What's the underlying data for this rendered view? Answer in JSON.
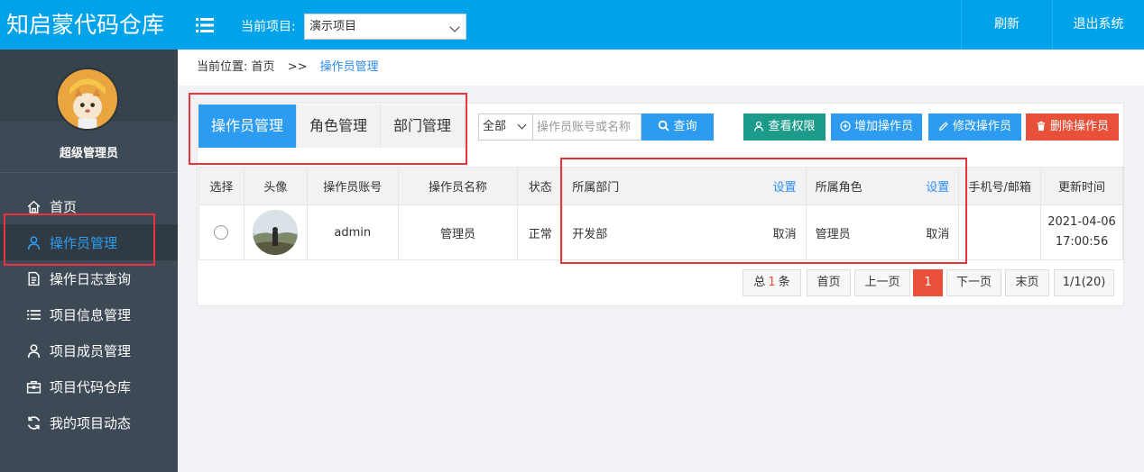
{
  "app": {
    "brand": "知启蒙代码仓库"
  },
  "sidebar": {
    "user_name": "超级管理员",
    "items": [
      {
        "label": "首页",
        "icon": "home-icon"
      },
      {
        "label": "操作员管理",
        "icon": "user-icon",
        "active": true
      },
      {
        "label": "操作日志查询",
        "icon": "document-icon"
      },
      {
        "label": "项目信息管理",
        "icon": "list-icon"
      },
      {
        "label": "项目成员管理",
        "icon": "user-icon"
      },
      {
        "label": "项目代码仓库",
        "icon": "briefcase-icon"
      },
      {
        "label": "我的项目动态",
        "icon": "refresh-icon"
      }
    ]
  },
  "header": {
    "project_label": "当前项目:",
    "project_value": "演示项目",
    "refresh": "刷新",
    "logout": "退出系统"
  },
  "breadcrumb": {
    "prefix": "当前位置:",
    "home": "首页",
    "sep": ">>",
    "current": "操作员管理"
  },
  "tabs": [
    {
      "label": "操作员管理",
      "active": true
    },
    {
      "label": "角色管理"
    },
    {
      "label": "部门管理"
    }
  ],
  "filter": {
    "scope": "全部",
    "placeholder": "操作员账号或名称",
    "query": "查询"
  },
  "actions": {
    "perm": "查看权限",
    "add": "增加操作员",
    "edit": "修改操作员",
    "del": "删除操作员"
  },
  "table": {
    "headers": {
      "select": "选择",
      "avatar": "头像",
      "account": "操作员账号",
      "name": "操作员名称",
      "status": "状态",
      "dept": "所属部门",
      "dept_set": "设置",
      "role": "所属角色",
      "role_set": "设置",
      "contact": "手机号/邮箱",
      "updated": "更新时间"
    },
    "rows": [
      {
        "account": "admin",
        "name": "管理员",
        "status": "正常",
        "dept": "开发部",
        "dept_cancel": "取消",
        "role": "管理员",
        "role_cancel": "取消",
        "contact": "",
        "updated_date": "2021-04-06",
        "updated_time": "17:00:56"
      }
    ]
  },
  "pager": {
    "total_prefix": "总",
    "total": "1",
    "total_suffix": "条",
    "first": "首页",
    "prev": "上一页",
    "page": "1",
    "next": "下一页",
    "last": "末页",
    "info": "1/1(20)"
  },
  "colors": {
    "header_bg": "#00a2e9",
    "sidebar_bg": "#3d4a55",
    "primary": "#2d9cf0",
    "teal": "#1d9b8a",
    "danger": "#e8503a",
    "annotation": "#e8343a"
  }
}
